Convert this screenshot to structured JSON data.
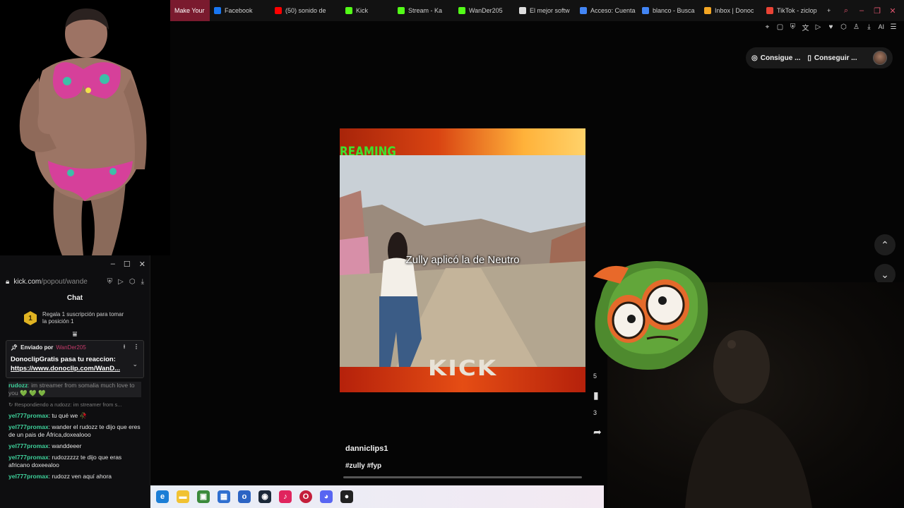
{
  "browser": {
    "tabs": [
      {
        "label": "Make Your",
        "icon": "tab-favicon",
        "color": "#7a1a2e",
        "active": true
      },
      {
        "label": "Facebook",
        "icon": "facebook-icon",
        "color": "#1877f2"
      },
      {
        "label": "(50) sonido de",
        "icon": "youtube-icon",
        "color": "#ff0000"
      },
      {
        "label": "Kick",
        "icon": "kick-icon",
        "color": "#53fc18"
      },
      {
        "label": "Stream - Ka",
        "icon": "kick-icon",
        "color": "#53fc18"
      },
      {
        "label": "WanDer205",
        "icon": "kick-icon",
        "color": "#53fc18"
      },
      {
        "label": "El mejor softw",
        "icon": "app-icon",
        "color": "#dddddd"
      },
      {
        "label": "Acceso: Cuenta",
        "icon": "google-icon",
        "color": "#4285f4"
      },
      {
        "label": "blanco - Busca",
        "icon": "google-icon",
        "color": "#4285f4"
      },
      {
        "label": "Inbox | Donoc",
        "icon": "donoclip-icon",
        "color": "#f4a623"
      },
      {
        "label": "TikTok - ziclop",
        "icon": "gmail-icon",
        "color": "#ea4335"
      }
    ],
    "new_tab": "+",
    "toolbar_ai_label": "AI"
  },
  "top_chips": {
    "first": "Consigue ...",
    "second": "Conseguir ..."
  },
  "chat": {
    "url_host": "kick.com",
    "url_path": "/popout/wande",
    "title": "Chat",
    "sub_badge": "1",
    "sub_promo": "Regala 1 suscripción para tomar la posición 1",
    "pinned": {
      "sent_by": "Enviado por",
      "user": "WanDer205",
      "message": "DonoclipGratis pasa tu reaccion:",
      "link": "https://www.donoclip.com/WanD..."
    },
    "messages": [
      {
        "user": "rudozz",
        "text": "im streamer from somalia much love to you 💚 💚 💚",
        "faded": true
      },
      {
        "reply": "↻ Respondiendo a rudozz: im streamer from s..."
      },
      {
        "user": "yel777promax",
        "text": "tu qué we 🥀"
      },
      {
        "user": "yel777promax",
        "text": "wander el rudozz te dijo que eres de un pais de África,doxealooo"
      },
      {
        "user": "yel777promax",
        "text": "wanddeeer"
      },
      {
        "user": "yel777promax",
        "text": "rudozzzzz te dijo que eras africano doxeealoo"
      },
      {
        "user": "yel777promax",
        "text": "rudozz ven aquí ahora"
      }
    ]
  },
  "video": {
    "banner_text": "REAMING",
    "caption": "Zully aplicó la de Neutro",
    "logo_text": "KICK",
    "channel": "danniclips1",
    "hashtags": "#zully #fyp",
    "progress": 0.0
  },
  "colors": {
    "accent": "#e0556f",
    "chat_username": "#3ed19b",
    "kick_green": "#53fc18"
  }
}
